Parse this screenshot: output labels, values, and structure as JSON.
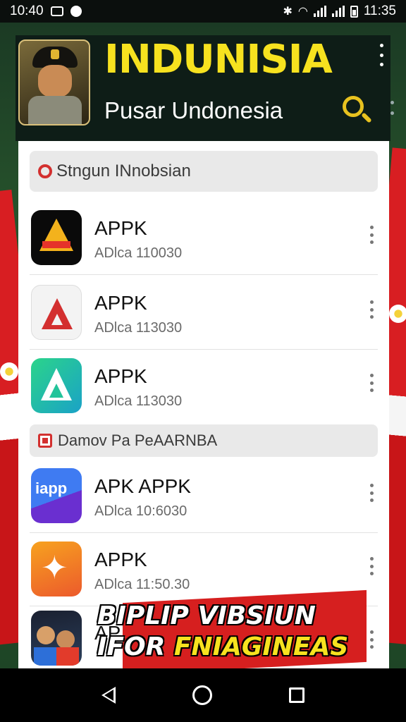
{
  "status_bar": {
    "time_left": "10:40",
    "time_right": "11:35"
  },
  "header": {
    "title": "INDUNISIA",
    "subtitle": "Pusar Undonesia"
  },
  "sections": [
    {
      "label": "Stngun INnobsian"
    },
    {
      "label": "Damov Pa PeAARNBA"
    }
  ],
  "apps": [
    {
      "name": "APPK",
      "meta": "ADlca 110030",
      "icon": "red-triangle-logo-icon"
    },
    {
      "name": "APPK",
      "meta": "ADlca 113030",
      "icon": "red-a-logo-icon"
    },
    {
      "name": "APPK",
      "meta": "ADlca 113030",
      "icon": "green-a-logo-icon"
    },
    {
      "name": "APK APPK",
      "meta": "ADlca 10:6030",
      "icon": "blue-iapp-logo-icon",
      "icon_text": "iapp"
    },
    {
      "name": "APPK",
      "meta": "ADlca 11:50.30",
      "icon": "orange-star-logo-icon"
    },
    {
      "name": "AP",
      "meta": "",
      "icon": "people-logo-icon"
    }
  ],
  "promo": {
    "line1": "BIPLIP VIBSIUN",
    "line2_prefix": "IFOR ",
    "line2_highlight": "FNIAGINEAS"
  },
  "colors": {
    "title_yellow": "#f7e21f",
    "header_bg": "#0e1d17",
    "flag_red": "#d81e22",
    "search_icon": "#e8c21f"
  }
}
